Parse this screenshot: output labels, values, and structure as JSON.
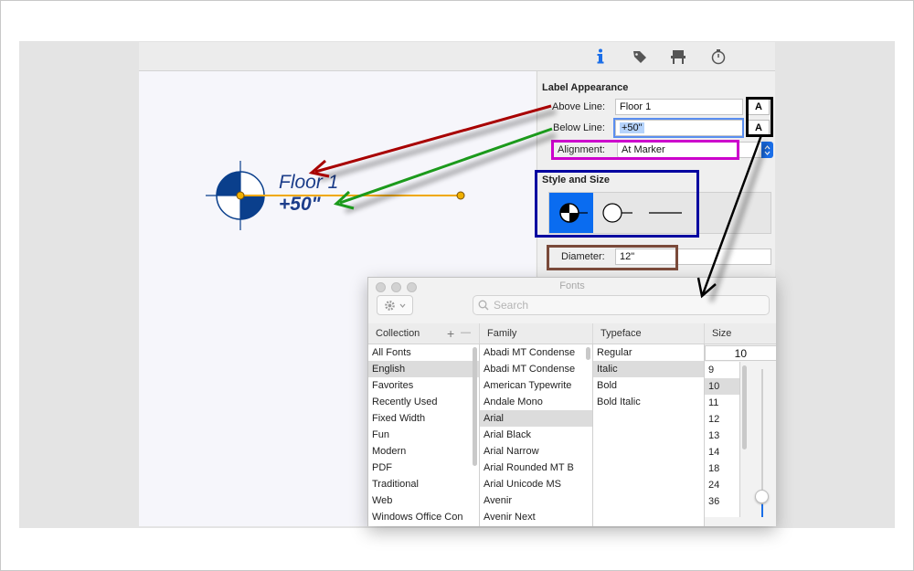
{
  "toolbar": {
    "icons": [
      "info-icon",
      "tag-icon",
      "chair-icon",
      "stopwatch-icon"
    ]
  },
  "canvas": {
    "marker_line1": "Floor 1",
    "marker_line2": "+50\""
  },
  "inspector": {
    "section_label": "Label Appearance",
    "above_line": {
      "label": "Above Line:",
      "value": "Floor 1",
      "font_button": "A"
    },
    "below_line": {
      "label": "Below Line:",
      "value": "+50\"",
      "font_button": "A"
    },
    "alignment": {
      "label": "Alignment:",
      "value": "At Marker"
    },
    "style_section": "Style and Size",
    "diameter": {
      "label": "Diameter:",
      "value": "12\""
    }
  },
  "fonts_panel": {
    "title": "Fonts",
    "search_placeholder": "Search",
    "headers": {
      "collection": "Collection",
      "family": "Family",
      "typeface": "Typeface",
      "size": "Size"
    },
    "add_symbol": "+",
    "remove_symbol": "—",
    "collections": [
      "All Fonts",
      "English",
      "Favorites",
      "Recently Used",
      "Fixed Width",
      "Fun",
      "Modern",
      "PDF",
      "Traditional",
      "Web",
      "Windows Office Con"
    ],
    "collection_selected": "English",
    "families": [
      "Abadi MT Condense",
      "Abadi MT Condense",
      "American Typewrite",
      "Andale Mono",
      "Arial",
      "Arial Black",
      "Arial Narrow",
      "Arial Rounded MT B",
      "Arial Unicode MS",
      "Avenir",
      "Avenir Next"
    ],
    "family_selected": "Arial",
    "typefaces": [
      "Regular",
      "Italic",
      "Bold",
      "Bold Italic"
    ],
    "typeface_selected": "Italic",
    "size_value": "10",
    "sizes": [
      "9",
      "10",
      "11",
      "12",
      "13",
      "14",
      "18",
      "24",
      "36"
    ],
    "size_selected": "10"
  },
  "colors": {
    "marker_blue": "#0a3f8c",
    "label_blue": "#1c3d8a",
    "selection_blue": "#0a6cf0",
    "arrow_red": "#a80000",
    "arrow_green": "#1c9a1c",
    "highlight_black": "#000000",
    "highlight_navy": "#0000a0",
    "highlight_magenta": "#cc00cc",
    "highlight_brown": "#7a4a3a",
    "highlight_blue_field": "#5a8ef0"
  }
}
